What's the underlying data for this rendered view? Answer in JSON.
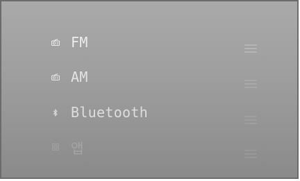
{
  "menu": {
    "items": [
      {
        "label": "FM",
        "icon": "radio-icon"
      },
      {
        "label": "AM",
        "icon": "radio-icon"
      },
      {
        "label": "Bluetooth",
        "icon": "bluetooth-icon"
      },
      {
        "label": "앱",
        "icon": "apps-grid-icon"
      }
    ]
  }
}
